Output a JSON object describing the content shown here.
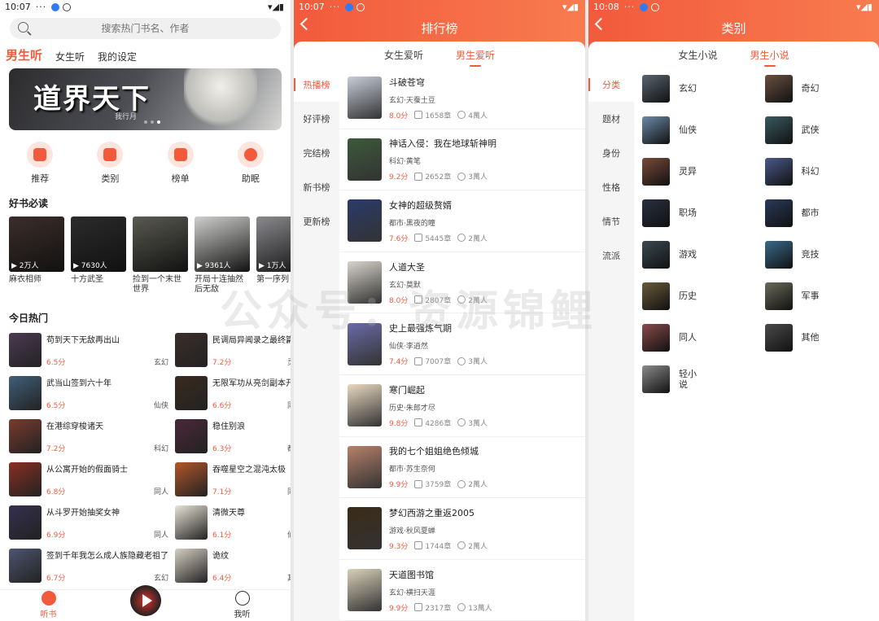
{
  "colors": {
    "accent": "#f25a3c"
  },
  "screen1": {
    "status": {
      "time": "10:07",
      "dots": "···",
      "right": "▾◢▮"
    },
    "search": {
      "placeholder": "搜索热门书名、作者"
    },
    "tabs": [
      {
        "label": "男生听",
        "active": true
      },
      {
        "label": "女生听"
      },
      {
        "label": "我的设定"
      }
    ],
    "banner": {
      "title": "道界天下",
      "author": "我行月"
    },
    "quick": [
      {
        "label": "推荐",
        "icon": "recommend-icon"
      },
      {
        "label": "类别",
        "icon": "category-icon"
      },
      {
        "label": "榜单",
        "icon": "ranking-icon"
      },
      {
        "label": "助眠",
        "icon": "sleep-icon"
      }
    ],
    "must_read": {
      "title": "好书必读",
      "items": [
        {
          "name": "麻衣相师",
          "count": "▶ 2万人",
          "color": "#3b2e2a"
        },
        {
          "name": "十方武圣",
          "count": "▶ 7630人",
          "color": "#2b2b2b"
        },
        {
          "name": "捡到一个末世世界",
          "count": "",
          "color": "#5a5a52"
        },
        {
          "name": "开局十连抽然后无敌",
          "count": "▶ 9361人",
          "color": "#cfcfcd"
        },
        {
          "name": "第一序列",
          "count": "▶ 1万人",
          "color": "#8a8a8e"
        }
      ]
    },
    "hot": {
      "title": "今日热门",
      "items": [
        {
          "title": "苟到天下无敌再出山",
          "score": "6.5分",
          "cat": "玄幻",
          "color": "#4a3b52"
        },
        {
          "title": "民调局异闻录之最终篇章",
          "score": "7.2分",
          "cat": "灵异",
          "color": "#3a2e2a"
        },
        {
          "title": "武当山签到六十年",
          "score": "6.5分",
          "cat": "仙侠",
          "color": "#3f5f7a"
        },
        {
          "title": "无限军功从亮剑副本开始",
          "score": "6.6分",
          "cat": "同人",
          "color": "#3a2a20"
        },
        {
          "title": "在港综穿梭诸天",
          "score": "7.2分",
          "cat": "科幻",
          "color": "#7a3b2e"
        },
        {
          "title": "稳住别浪",
          "score": "6.3分",
          "cat": "都市",
          "color": "#4b2838"
        },
        {
          "title": "从公寓开始的假面骑士",
          "score": "6.8分",
          "cat": "同人",
          "color": "#8a2f22"
        },
        {
          "title": "吞噬星空之混沌太极",
          "score": "7.1分",
          "cat": "同人",
          "color": "#b3562a"
        },
        {
          "title": "从斗罗开始抽奖女神",
          "score": "6.9分",
          "cat": "同人",
          "color": "#35304f"
        },
        {
          "title": "清微天尊",
          "score": "6.1分",
          "cat": "仙侠",
          "color": "#e9e4d8"
        },
        {
          "title": "签到千年我怎么成人族隐藏老祖了",
          "score": "6.7分",
          "cat": "玄幻",
          "color": "#4d5570"
        },
        {
          "title": "诡纹",
          "score": "6.4分",
          "cat": "其他",
          "color": "#d6d0c4"
        }
      ]
    },
    "nav": [
      {
        "label": "听书",
        "active": true
      },
      {
        "label": ""
      },
      {
        "label": "我听"
      }
    ]
  },
  "screen2": {
    "status": {
      "time": "10:07",
      "dots": "···",
      "right": "▾◢▮"
    },
    "title": "排行榜",
    "tabs": [
      {
        "label": "女生爱听"
      },
      {
        "label": "男生爱听",
        "active": true
      }
    ],
    "menu": [
      {
        "label": "热播榜",
        "active": true
      },
      {
        "label": "好评榜"
      },
      {
        "label": "完结榜"
      },
      {
        "label": "新书榜"
      },
      {
        "label": "更新榜"
      }
    ],
    "items": [
      {
        "title": "斗破苍穹",
        "sub": "玄幻·天蚕土豆",
        "score": "8.0分",
        "chapters": "1658章",
        "listeners": "4萬人",
        "color": "#c8cdd8"
      },
      {
        "title": "神话入侵：我在地球斩神明",
        "sub": "科幻·黄笔",
        "score": "9.2分",
        "chapters": "2652章",
        "listeners": "3萬人",
        "color": "#3c5a3a"
      },
      {
        "title": "女神的超级赘婿",
        "sub": "都市·黑夜的瞳",
        "score": "7.6分",
        "chapters": "5445章",
        "listeners": "2萬人",
        "color": "#2a3a6a"
      },
      {
        "title": "人道大圣",
        "sub": "玄幻·莫默",
        "score": "8.0分",
        "chapters": "2807章",
        "listeners": "2萬人",
        "color": "#d8d4cc"
      },
      {
        "title": "史上最强炼气期",
        "sub": "仙侠·李逍然",
        "score": "7.4分",
        "chapters": "7007章",
        "listeners": "3萬人",
        "color": "#6a6aa8"
      },
      {
        "title": "寒门崛起",
        "sub": "历史·朱郎才尽",
        "score": "9.8分",
        "chapters": "4286章",
        "listeners": "3萬人",
        "color": "#e8d8c0"
      },
      {
        "title": "我的七个姐姐绝色倾城",
        "sub": "都市·苏生奈何",
        "score": "9.9分",
        "chapters": "3759章",
        "listeners": "2萬人",
        "color": "#b8806a"
      },
      {
        "title": "梦幻西游之重返2005",
        "sub": "游戏·秋风夏蝉",
        "score": "9.3分",
        "chapters": "1744章",
        "listeners": "2萬人",
        "color": "#3a2a18"
      },
      {
        "title": "天道图书馆",
        "sub": "玄幻·横扫天涯",
        "score": "9.9分",
        "chapters": "2317章",
        "listeners": "13萬人",
        "color": "#d8d0b8"
      }
    ]
  },
  "screen3": {
    "status": {
      "time": "10:08",
      "dots": "···",
      "right": "▾◢▮"
    },
    "title": "类别",
    "tabs": [
      {
        "label": "女生小说"
      },
      {
        "label": "男生小说",
        "active": true
      }
    ],
    "menu": [
      {
        "label": "分类",
        "active": true
      },
      {
        "label": "题材"
      },
      {
        "label": "身份"
      },
      {
        "label": "性格"
      },
      {
        "label": "情节"
      },
      {
        "label": "流派"
      }
    ],
    "categories": [
      {
        "label": "玄幻",
        "color": "#5a6470"
      },
      {
        "label": "奇幻",
        "color": "#6a5040"
      },
      {
        "label": "仙侠",
        "color": "#6a8aa8"
      },
      {
        "label": "武侠",
        "color": "#3a5a60"
      },
      {
        "label": "灵异",
        "color": "#7a4a3a"
      },
      {
        "label": "科幻",
        "color": "#4a5a8a"
      },
      {
        "label": "职场",
        "color": "#2a3040"
      },
      {
        "label": "都市",
        "color": "#2a3a5a"
      },
      {
        "label": "游戏",
        "color": "#3a4a50"
      },
      {
        "label": "竞技",
        "color": "#3a6a8a"
      },
      {
        "label": "历史",
        "color": "#6a5a3a"
      },
      {
        "label": "军事",
        "color": "#6a6a5a"
      },
      {
        "label": "同人",
        "color": "#8a4a4a"
      },
      {
        "label": "其他",
        "color": "#4a4a4a"
      },
      {
        "label": "轻小说",
        "color": "#8a8a8a"
      }
    ]
  },
  "watermark": "公众号：资源锦鲤"
}
